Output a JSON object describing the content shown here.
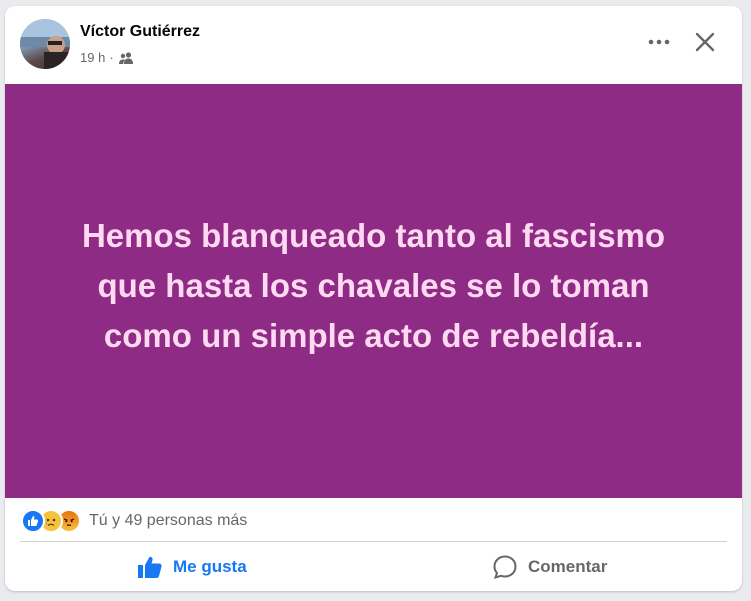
{
  "post": {
    "author": "Víctor Gutiérrez",
    "time": "19 h",
    "separator": "·",
    "audience_icon": "friends-icon",
    "text": "Hemos blanqueado tanto al fascismo\nque hasta los chavales se lo toman\ncomo un simple acto de rebeldía...",
    "background_color": "#8e2c85",
    "text_color": "#ffd8f2"
  },
  "reactions": {
    "icons": [
      "like-reaction-icon",
      "sad-reaction-icon",
      "angry-reaction-icon"
    ],
    "summary": "Tú y 49 personas más"
  },
  "actions": {
    "like_label": "Me gusta",
    "comment_label": "Comentar"
  },
  "colors": {
    "accent": "#1877f2",
    "secondary_text": "#65676b"
  }
}
